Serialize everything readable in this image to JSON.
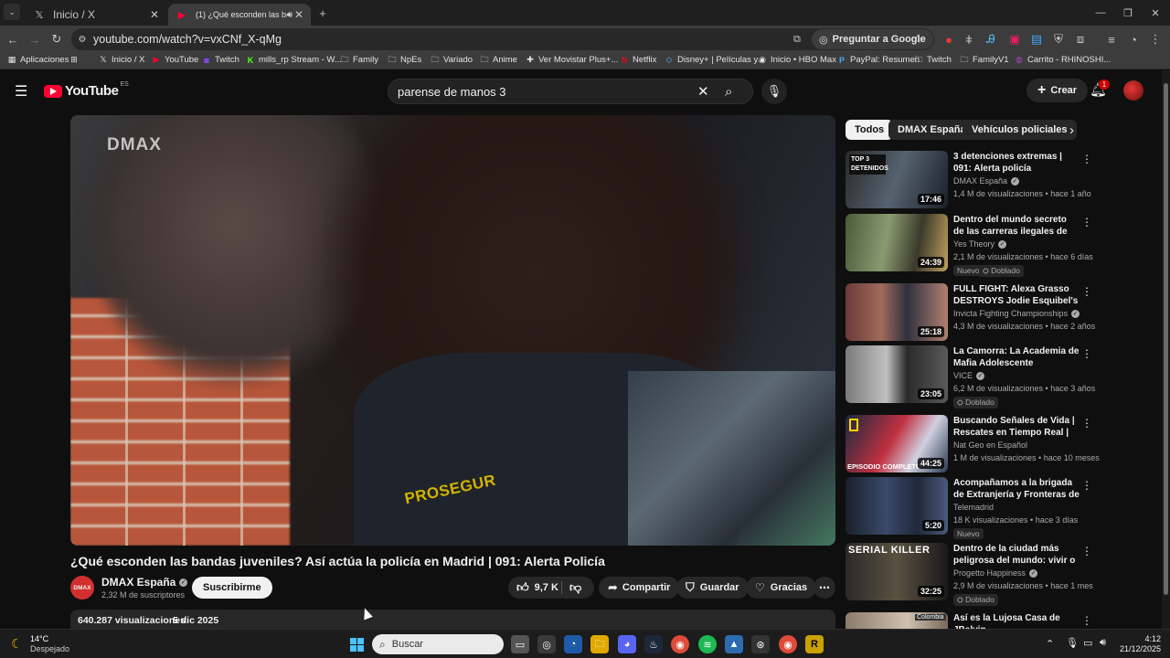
{
  "browser": {
    "tabs": [
      {
        "label": "Inicio / X",
        "icon": "x-logo-icon"
      },
      {
        "label": "(1) ¿Qué esconden las banda",
        "icon": "youtube-icon"
      }
    ],
    "url": "youtube.com/watch?v=vxCNf_X-qMg",
    "ask_google": "Preguntar a Google",
    "bookmarks": [
      "Aplicaciones",
      "Inicio / X",
      "YouTube",
      "Twitch",
      "mills_rp Stream - W...",
      "Family",
      "NpEs",
      "Variado",
      "Anime",
      "Ver Movistar Plus+...",
      "Netflix",
      "Disney+ | Películas y...",
      "Inicio • HBO Max",
      "PayPal: Resumen",
      "Twitch",
      "FamilyV1",
      "Carrito - RHINOSHI..."
    ]
  },
  "youtube": {
    "logo_text": "YouTube",
    "region": "ES",
    "search_query": "parense de manos 3",
    "create_label": "Crear",
    "notif_count": "1",
    "player_watermark": "DMAX",
    "video_title": "¿Qué esconden las bandas juveniles? Así actúa la policía en Madrid | 091: Alerta Policía",
    "channel_name": "DMAX España",
    "subscribers": "2,32 M de suscriptores",
    "subscribe_label": "Suscribirme",
    "likes": "9,7 K",
    "share_label": "Compartir",
    "save_label": "Guardar",
    "thanks_label": "Gracias",
    "views": "640.287 visualizaciones",
    "date": "5 dic 2025",
    "chips": [
      "Todos",
      "DMAX España",
      "Vehículos policiales"
    ],
    "recommendations": [
      {
        "title": "3 detenciones extremas | 091: Alerta policía",
        "channel": "DMAX España",
        "meta": "1,4 M de visualizaciones • hace 1 año",
        "duration": "17:46",
        "thumb_text": "TOP 3 DETENIDOS",
        "badges": []
      },
      {
        "title": "Dentro del mundo secreto de las carreras ilegales de driftin...",
        "channel": "Yes Theory",
        "meta": "2,1 M de visualizaciones • hace 6 días",
        "duration": "24:39",
        "thumb_text": "",
        "badges": [
          "Nuevo",
          "Doblado"
        ]
      },
      {
        "title": "FULL FIGHT: Alexa Grasso DESTROYS Jodie Esquibel's ...",
        "channel": "Invicta Fighting Championships",
        "meta": "4,3 M de visualizaciones • hace 2 años",
        "duration": "25:18",
        "thumb_text": "",
        "badges": []
      },
      {
        "title": "La Camorra: La Academia de Mafia Adolescente",
        "channel": "VICE",
        "meta": "6,2 M de visualizaciones • hace 3 años",
        "duration": "23:05",
        "thumb_text": "",
        "badges": [
          "Doblado"
        ]
      },
      {
        "title": "Buscando Señales de Vida | Rescates en Tiempo Real | Nat...",
        "channel": "Nat Geo en Español",
        "meta": "1 M de visualizaciones • hace 10 meses",
        "duration": "44:25",
        "thumb_text": "EPISODIO COMPLETO",
        "badges": []
      },
      {
        "title": "Acompañamos a la brigada de Extranjería y Fronteras de la ...",
        "channel": "Telemadrid",
        "meta": "18 K visualizaciones • hace 3 días",
        "duration": "5:20",
        "thumb_text": "",
        "badges": [
          "Nuevo"
        ]
      },
      {
        "title": "Dentro de la ciudad más peligrosa del mundo: vivir o ...",
        "channel": "Progetto Happiness",
        "meta": "2,9 M de visualizaciones • hace 1 mes",
        "duration": "32:25",
        "thumb_text": "SERIAL KILLER",
        "badges": [
          "Doblado"
        ]
      },
      {
        "title": "Así es la Lujosa Casa de JBalvin",
        "channel": "",
        "meta": "",
        "duration": "",
        "thumb_text": "Colombia",
        "badges": []
      }
    ]
  },
  "taskbar": {
    "temp": "14°C",
    "weather": "Despejado",
    "search_placeholder": "Buscar",
    "time": "4:12",
    "date": "21/12/2025"
  },
  "colors": {
    "youtube_red": "#ff0033",
    "bg": "#0f0f0f",
    "chip": "#272727"
  }
}
